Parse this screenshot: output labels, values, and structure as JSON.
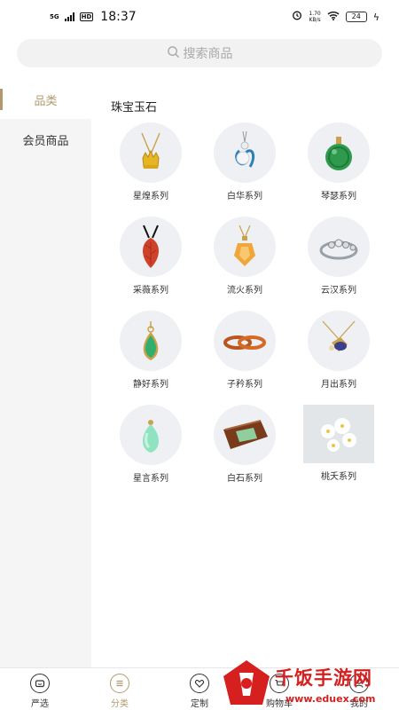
{
  "status_bar": {
    "network": "5G",
    "hd": "HD",
    "time": "18:37",
    "speed_value": "1.70",
    "speed_unit": "KB/s",
    "battery": "24"
  },
  "search": {
    "placeholder": "搜索商品"
  },
  "sidebar": {
    "items": [
      {
        "label": "品类",
        "active": true
      },
      {
        "label": "会员商品",
        "active": false
      }
    ]
  },
  "section": {
    "title": "珠宝玉石"
  },
  "products": [
    {
      "label": "星煌系列",
      "icon": "gold-crown-necklace"
    },
    {
      "label": "白华系列",
      "icon": "white-jade-pendant"
    },
    {
      "label": "琴瑟系列",
      "icon": "green-jade-ball"
    },
    {
      "label": "采薇系列",
      "icon": "red-leaf-pendant"
    },
    {
      "label": "流火系列",
      "icon": "citrine-pendant"
    },
    {
      "label": "云汉系列",
      "icon": "crystal-ring"
    },
    {
      "label": "静好系列",
      "icon": "green-drop-pendant"
    },
    {
      "label": "子矜系列",
      "icon": "amber-bangles"
    },
    {
      "label": "月出系列",
      "icon": "sapphire-necklace"
    },
    {
      "label": "星言系列",
      "icon": "jade-drop"
    },
    {
      "label": "白石系列",
      "icon": "stone-slab"
    },
    {
      "label": "桃夭系列",
      "icon": "white-flowers"
    }
  ],
  "bottom_nav": [
    {
      "label": "严选",
      "icon": "tv-icon",
      "active": false
    },
    {
      "label": "分类",
      "icon": "list-icon",
      "active": true
    },
    {
      "label": "定制",
      "icon": "heart-icon",
      "active": false
    },
    {
      "label": "购物车",
      "icon": "cart-icon",
      "active": false
    },
    {
      "label": "我的",
      "icon": "user-icon",
      "active": false
    }
  ],
  "watermark": {
    "text": "千饭手游网",
    "url": "www.eduex.com"
  },
  "colors": {
    "accent": "#b09a6d",
    "sidebar_bg": "#f5f5f5",
    "watermark": "#d62020"
  }
}
